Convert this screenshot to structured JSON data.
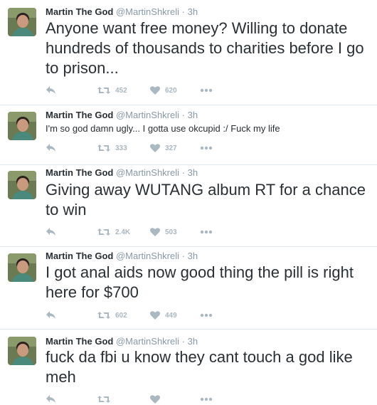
{
  "colors": {
    "name": "#292f33",
    "meta": "#8899a6",
    "action": "#aab8c2",
    "divider": "#e1e8ed"
  },
  "icons": {
    "reply": "reply-icon",
    "retweet": "retweet-icon",
    "like": "heart-icon",
    "more": "more-dots-icon"
  },
  "tweets": [
    {
      "fullname": "Martin The God",
      "handle": "@MartinShkreli",
      "dot": "·",
      "time": "3h",
      "text": "Anyone want free money? Willing to donate hundreds of thousands to charities before I go to prison...",
      "retweets": "452",
      "likes": "620"
    },
    {
      "fullname": "Martin The God",
      "handle": "@MartinShkreli",
      "dot": "·",
      "time": "3h",
      "text": "I'm so god damn ugly... I gotta use okcupid :/ Fuck my life",
      "retweets": "333",
      "likes": "327"
    },
    {
      "fullname": "Martin The God",
      "handle": "@MartinShkreli",
      "dot": "·",
      "time": "3h",
      "text": "Giving away WUTANG album RT for a chance to win",
      "retweets": "2.4K",
      "likes": "503"
    },
    {
      "fullname": "Martin The God",
      "handle": "@MartinShkreli",
      "dot": "·",
      "time": "3h",
      "text": "I got anal aids now good thing the pill is right here for $700",
      "retweets": "602",
      "likes": "449"
    },
    {
      "fullname": "Martin The God",
      "handle": "@MartinShkreli",
      "dot": "·",
      "time": "3h",
      "text": "fuck da fbi u know they cant touch a god like meh",
      "retweets": "",
      "likes": ""
    }
  ]
}
